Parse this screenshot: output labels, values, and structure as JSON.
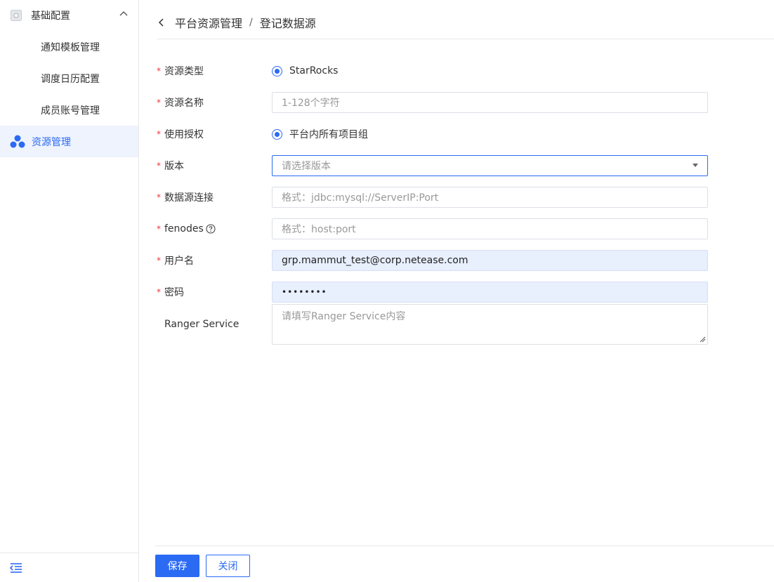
{
  "sidebar": {
    "group_label": "基础配置",
    "sub_items": [
      {
        "label": "通知模板管理"
      },
      {
        "label": "调度日历配置"
      },
      {
        "label": "成员账号管理"
      }
    ],
    "active_item": "资源管理"
  },
  "breadcrumb": {
    "parent": "平台资源管理",
    "separator": "/",
    "current": "登记数据源"
  },
  "form": {
    "resource_type": {
      "label": "资源类型",
      "value": "StarRocks"
    },
    "resource_name": {
      "label": "资源名称",
      "placeholder": "1-128个字符"
    },
    "authorization": {
      "label": "使用授权",
      "value": "平台内所有项目组"
    },
    "version": {
      "label": "版本",
      "placeholder": "请选择版本"
    },
    "connection": {
      "label": "数据源连接",
      "placeholder": "格式：jdbc:mysql://ServerIP:Port"
    },
    "fenodes": {
      "label": "fenodes",
      "placeholder": "格式：host:port"
    },
    "username": {
      "label": "用户名",
      "value": "grp.mammut_test@corp.netease.com"
    },
    "password": {
      "label": "密码",
      "value": "••••••••"
    },
    "ranger": {
      "label": "Ranger Service",
      "placeholder": "请填写Ranger Service内容"
    }
  },
  "actions": {
    "save": "保存",
    "close": "关闭"
  },
  "colors": {
    "primary": "#2b6af3",
    "required": "#e5383b",
    "active_bg": "#eef3fd"
  }
}
